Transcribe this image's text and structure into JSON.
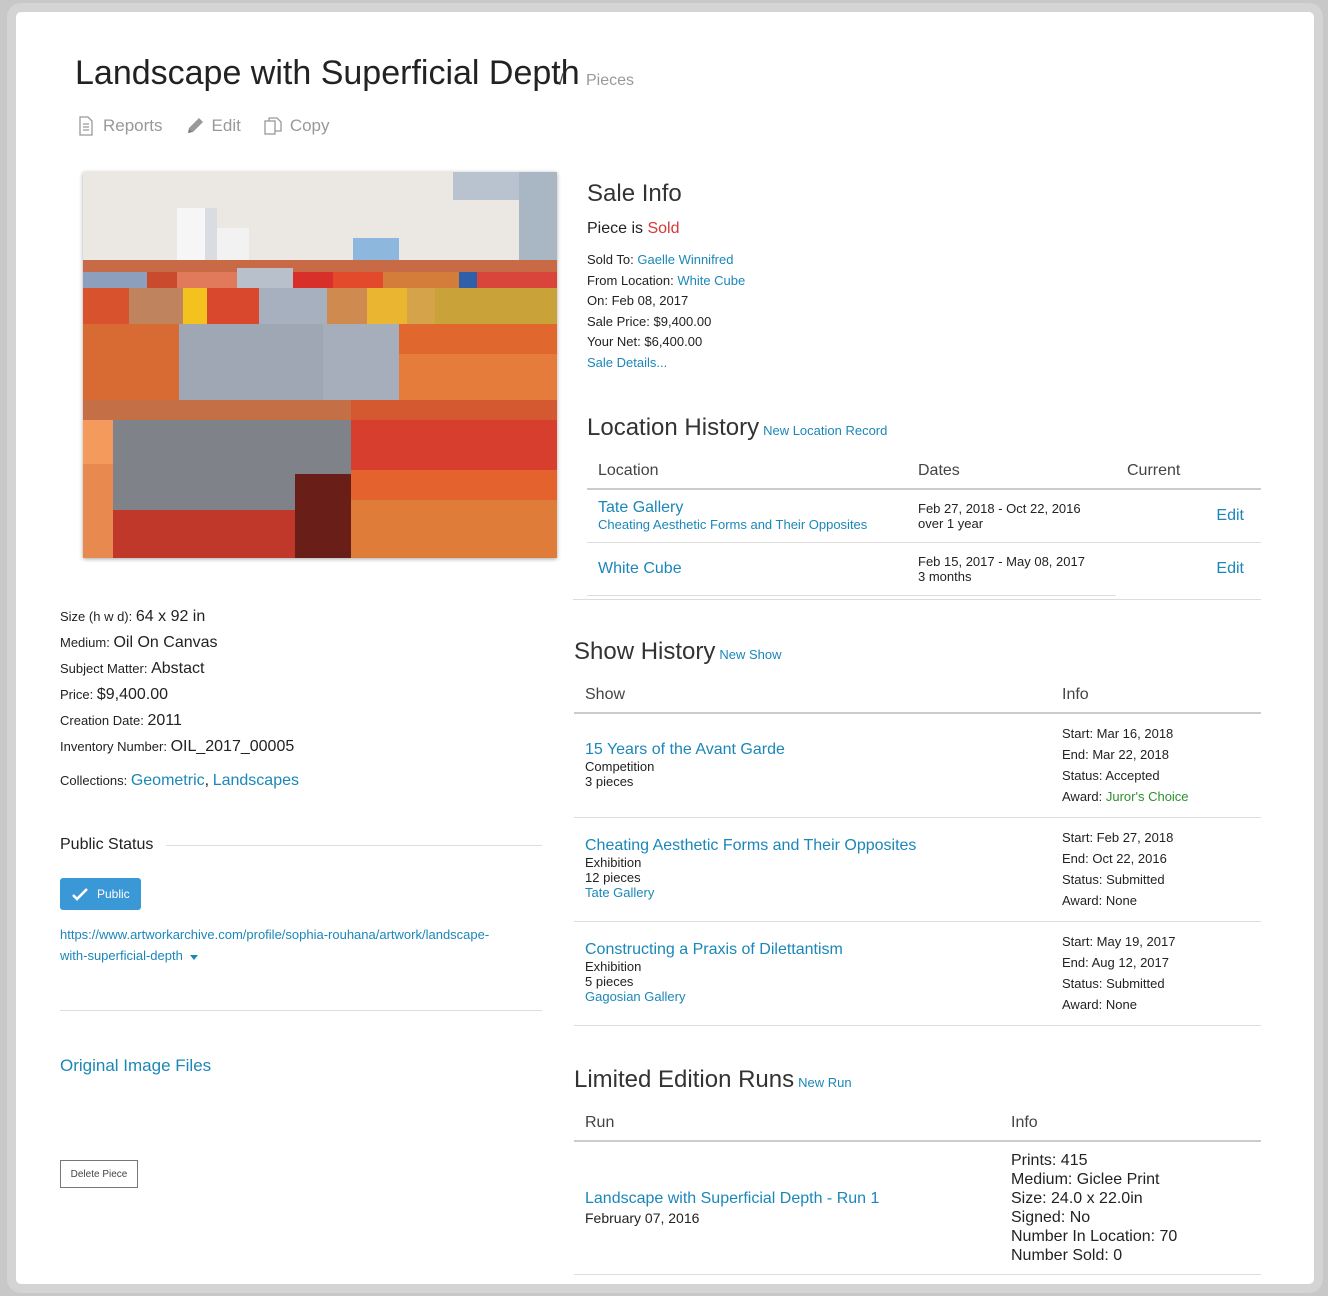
{
  "header": {
    "title": "Landscape with Superficial Depth",
    "separator": "/",
    "breadcrumb": "Pieces"
  },
  "toolbar": {
    "reports": "Reports",
    "edit": "Edit",
    "copy": "Copy"
  },
  "details": {
    "size_label": "Size (h w d):",
    "size": "64 x 92 in",
    "medium_label": "Medium:",
    "medium": "Oil On Canvas",
    "subject_label": "Subject Matter:",
    "subject": "Abstact",
    "price_label": "Price:",
    "price": "$9,400.00",
    "creation_label": "Creation Date:",
    "creation": "2011",
    "inventory_label": "Inventory Number:",
    "inventory": "OIL_2017_00005",
    "collections_label": "Collections:",
    "collections": [
      "Geometric",
      "Landscapes"
    ],
    "collections_sep": ","
  },
  "public_status": {
    "title": "Public Status",
    "button": "Public",
    "url_line1": "https://www.artworkarchive.com/profile/sophia-rouhana/artwork/landscape-",
    "url_line2": "with-superficial-depth"
  },
  "left_links": {
    "original_files": "Original Image Files",
    "delete": "Delete Piece"
  },
  "sale": {
    "title": "Sale Info",
    "status_prefix": "Piece is",
    "status": "Sold",
    "sold_to_label": "Sold To:",
    "sold_to": "Gaelle Winnifred",
    "from_label": "From Location:",
    "from": "White Cube",
    "on_label": "On:",
    "on": "Feb 08, 2017",
    "price_label": "Sale Price:",
    "price": "$9,400.00",
    "net_label": "Your Net:",
    "net": "$6,400.00",
    "details_link": "Sale Details..."
  },
  "location_history": {
    "title": "Location History",
    "new_link": "New Location Record",
    "columns": [
      "Location",
      "Dates",
      "Current"
    ],
    "rows": [
      {
        "location": "Tate Gallery",
        "sub": "Cheating Aesthetic Forms and Their Opposites",
        "dates": "Feb 27, 2018 - Oct 22, 2016",
        "duration": "over 1 year",
        "action": "Edit"
      },
      {
        "location": "White Cube",
        "sub": "",
        "dates": "Feb 15, 2017 - May 08, 2017",
        "duration": "3 months",
        "action": "Edit"
      }
    ]
  },
  "show_history": {
    "title": "Show History",
    "new_link": "New Show",
    "columns": [
      "Show",
      "Info"
    ],
    "rows": [
      {
        "name": "15 Years of the Avant Garde",
        "type": "Competition",
        "pieces": "3 pieces",
        "venue": "",
        "start": "Start: Mar 16, 2018",
        "end": "End: Mar 22, 2018",
        "status": "Status: Accepted",
        "award_label": "Award:",
        "award": "Juror's Choice"
      },
      {
        "name": "Cheating Aesthetic Forms and Their Opposites",
        "type": "Exhibition",
        "pieces": "12 pieces",
        "venue": "Tate Gallery",
        "start": "Start: Feb 27, 2018",
        "end": "End: Oct 22, 2016",
        "status": "Status: Submitted",
        "award_label": "Award:",
        "award": "None"
      },
      {
        "name": "Constructing a Praxis of Dilettantism",
        "type": "Exhibition",
        "pieces": "5 pieces",
        "venue": "Gagosian Gallery",
        "start": "Start: May 19, 2017",
        "end": "End: Aug 12, 2017",
        "status": "Status: Submitted",
        "award_label": "Award:",
        "award": "None"
      }
    ]
  },
  "edition_runs": {
    "title": "Limited Edition Runs",
    "new_link": "New Run",
    "columns": [
      "Run",
      "Info"
    ],
    "rows": [
      {
        "name": "Landscape with Superficial Depth - Run 1",
        "date": "February 07, 2016",
        "prints": "Prints: 415",
        "medium": "Medium: Giclee Print",
        "size": "Size: 24.0 x 22.0in",
        "signed": "Signed: No",
        "in_location": "Number In Location: 70",
        "sold": "Number Sold: 0"
      }
    ]
  },
  "colors": {
    "link": "#1b87b8",
    "sold": "#d43838",
    "award": "#2f8f2f",
    "button": "#3b98d6"
  }
}
